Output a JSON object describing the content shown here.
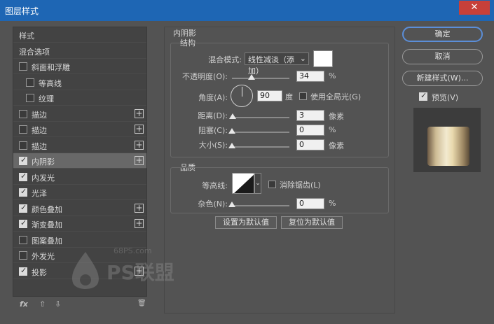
{
  "window": {
    "title": "图层样式",
    "close_glyph": "✕"
  },
  "style_list": {
    "items": [
      {
        "label": "样式",
        "checkbox": false,
        "checked": false,
        "plus": false,
        "indent": 0,
        "selected": false
      },
      {
        "label": "混合选项",
        "checkbox": false,
        "checked": false,
        "plus": false,
        "indent": 0,
        "selected": false
      },
      {
        "label": "斜面和浮雕",
        "checkbox": true,
        "checked": false,
        "plus": false,
        "indent": 0,
        "selected": false
      },
      {
        "label": "等高线",
        "checkbox": true,
        "checked": false,
        "plus": false,
        "indent": 1,
        "selected": false
      },
      {
        "label": "纹理",
        "checkbox": true,
        "checked": false,
        "plus": false,
        "indent": 1,
        "selected": false
      },
      {
        "label": "描边",
        "checkbox": true,
        "checked": false,
        "plus": true,
        "indent": 0,
        "selected": false
      },
      {
        "label": "描边",
        "checkbox": true,
        "checked": false,
        "plus": true,
        "indent": 0,
        "selected": false
      },
      {
        "label": "描边",
        "checkbox": true,
        "checked": false,
        "plus": true,
        "indent": 0,
        "selected": false
      },
      {
        "label": "内阴影",
        "checkbox": true,
        "checked": true,
        "plus": true,
        "indent": 0,
        "selected": true
      },
      {
        "label": "内发光",
        "checkbox": true,
        "checked": true,
        "plus": false,
        "indent": 0,
        "selected": false
      },
      {
        "label": "光泽",
        "checkbox": true,
        "checked": true,
        "plus": false,
        "indent": 0,
        "selected": false
      },
      {
        "label": "颜色叠加",
        "checkbox": true,
        "checked": true,
        "plus": true,
        "indent": 0,
        "selected": false
      },
      {
        "label": "渐变叠加",
        "checkbox": true,
        "checked": true,
        "plus": true,
        "indent": 0,
        "selected": false
      },
      {
        "label": "图案叠加",
        "checkbox": true,
        "checked": false,
        "plus": false,
        "indent": 0,
        "selected": false
      },
      {
        "label": "外发光",
        "checkbox": true,
        "checked": false,
        "plus": false,
        "indent": 0,
        "selected": false
      },
      {
        "label": "投影",
        "checkbox": true,
        "checked": true,
        "plus": true,
        "indent": 0,
        "selected": false
      }
    ],
    "footer": {
      "fx": "fx",
      "up": "⇧",
      "down": "⇩",
      "trash": "🗑"
    }
  },
  "panel": {
    "title": "内阴影",
    "structure": {
      "title": "结构",
      "blend_mode_label": "混合模式:",
      "blend_mode_value": "线性减淡（添加）",
      "blend_color": "#ffffff",
      "opacity_label": "不透明度(O):",
      "opacity_value": "34",
      "opacity_unit": "%",
      "angle_label": "角度(A):",
      "angle_value": "90",
      "angle_unit": "度",
      "global_light_label": "使用全局光(G)",
      "distance_label": "距离(D):",
      "distance_value": "3",
      "distance_unit": "像素",
      "choke_label": "阻塞(C):",
      "choke_value": "0",
      "choke_unit": "%",
      "size_label": "大小(S):",
      "size_value": "0",
      "size_unit": "像素"
    },
    "quality": {
      "title": "品质",
      "contour_label": "等高线:",
      "anti_alias_label": "消除锯齿(L)",
      "noise_label": "杂色(N):",
      "noise_value": "0",
      "noise_unit": "%"
    },
    "make_default": "设置为默认值",
    "reset_default": "复位为默认值"
  },
  "buttons": {
    "ok": "确定",
    "cancel": "取消",
    "new_style": "新建样式(W)...",
    "preview": "预览(V)"
  },
  "watermark": {
    "site": "68PS.com",
    "brand": "PS联盟"
  }
}
